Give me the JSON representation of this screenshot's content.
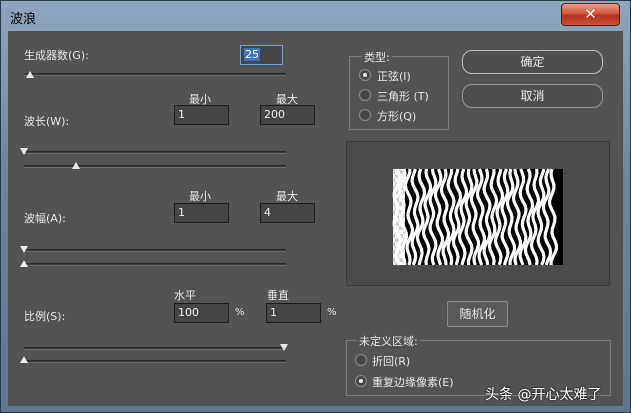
{
  "window": {
    "title": "波浪",
    "close_label": "✕"
  },
  "generators": {
    "label": "生成器数(G):",
    "value": "25"
  },
  "wavelength": {
    "label": "波长(W):",
    "min_header": "最小",
    "max_header": "最大",
    "min_value": "1",
    "max_value": "200"
  },
  "amplitude": {
    "label": "波幅(A):",
    "min_header": "最小",
    "max_header": "最大",
    "min_value": "1",
    "max_value": "4"
  },
  "scale": {
    "label": "比例(S):",
    "horizontal_header": "水平",
    "vertical_header": "垂直",
    "horizontal_value": "100",
    "vertical_value": "1",
    "unit": "%"
  },
  "type_group": {
    "title": "类型:",
    "options": [
      {
        "label": "正弦(I)",
        "selected": true
      },
      {
        "label": "三角形 (T)",
        "selected": false
      },
      {
        "label": "方形(Q)",
        "selected": false
      }
    ]
  },
  "buttons": {
    "ok": "确定",
    "cancel": "取消",
    "randomize": "随机化"
  },
  "undefined_area": {
    "title": "未定义区域:",
    "options": [
      {
        "label": "折回(R)",
        "selected": false
      },
      {
        "label": "重复边缘像素(E)",
        "selected": true
      }
    ]
  },
  "watermark": "头条 @开心太难了"
}
